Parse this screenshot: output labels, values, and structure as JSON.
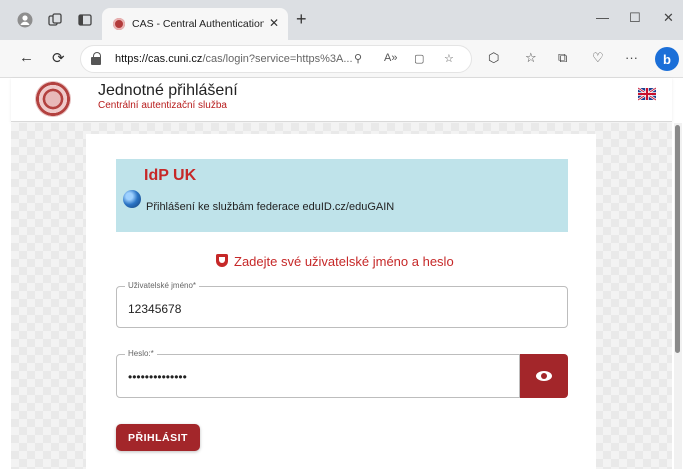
{
  "browser": {
    "tab_title": "CAS - Central Authentication Se",
    "new_tab": "+",
    "url_host": "https://cas.cuni.cz",
    "url_rest": "/cas/login?service=https%3A...",
    "window_controls": {
      "minimize": "—",
      "maximize": "☐",
      "close": "✕"
    }
  },
  "header": {
    "title": "Jednotné přihlášení",
    "subtitle": "Centrální autentizační služba"
  },
  "idp": {
    "title": "IdP UK",
    "text": "Přihlášení ke službám federace eduID.cz/eduGAIN"
  },
  "alert": {
    "text": "Zadejte své uživatelské jméno a heslo"
  },
  "form": {
    "username_label": "Uživatelské jméno*",
    "username_value": "12345678",
    "password_label": "Heslo:*",
    "password_value": "••••••••••••••",
    "submit_label": "PŘIHLÁSIT"
  },
  "colors": {
    "brand_red": "#a3262a",
    "idp_bg": "#bfe3ea",
    "accent_text": "#c62828"
  }
}
